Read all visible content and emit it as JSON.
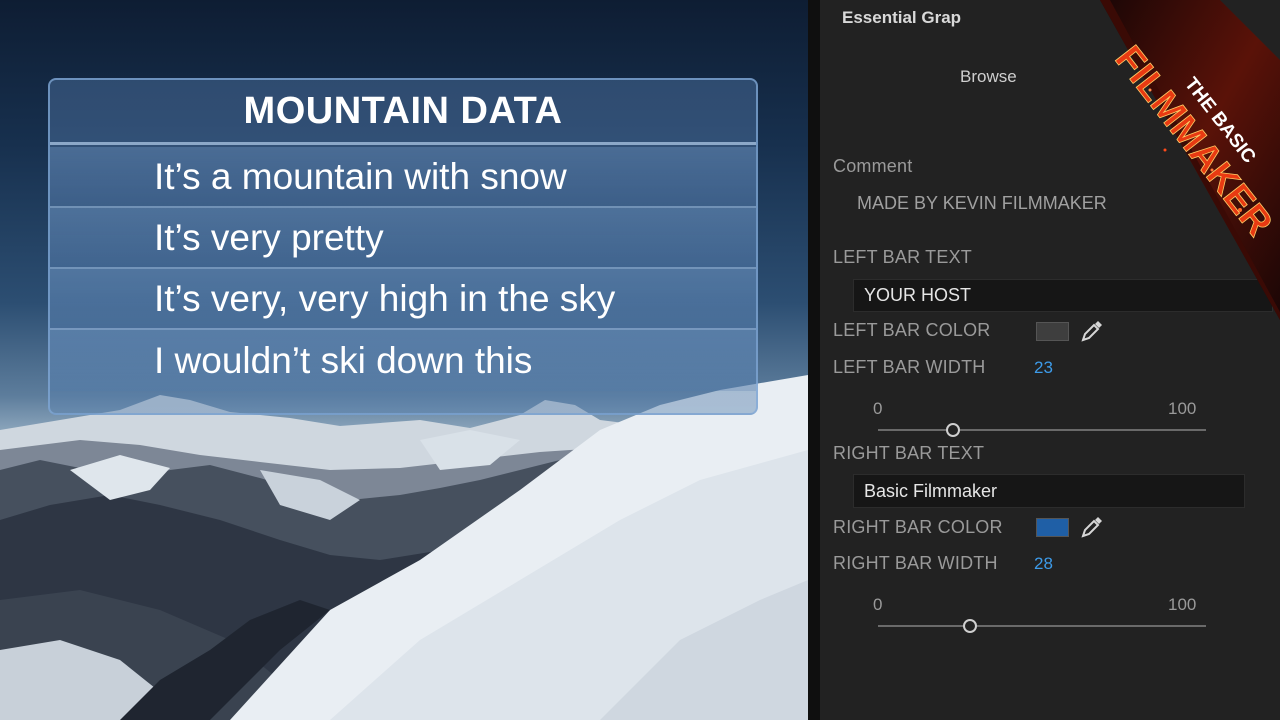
{
  "graphic": {
    "title": "MOUNTAIN DATA",
    "lines": [
      "It’s a mountain with snow",
      "It’s very pretty",
      "It’s very, very high in the sky",
      "I wouldn’t ski down this"
    ]
  },
  "panel": {
    "title": "Essential Grap",
    "browse_tab": "Browse",
    "comment_label": "Comment",
    "comment_value": "MADE BY KEVIN FILMMAKER",
    "left_bar": {
      "text_label": "LEFT BAR TEXT",
      "text_value": "YOUR HOST",
      "color_label": "LEFT BAR COLOR",
      "color": "#3e3e3e",
      "width_label": "LEFT BAR WIDTH",
      "width_value": "23",
      "slider_min": "0",
      "slider_max": "100"
    },
    "right_bar": {
      "text_label": "RIGHT BAR TEXT",
      "text_value": "Basic Filmmaker",
      "color_label": "RIGHT BAR COLOR",
      "color": "#1f5fa6",
      "width_label": "RIGHT BAR WIDTH",
      "width_value": "28",
      "slider_min": "0",
      "slider_max": "100"
    }
  },
  "watermark": {
    "line1": "THE BASIC",
    "line2": "FILMMAKER"
  }
}
